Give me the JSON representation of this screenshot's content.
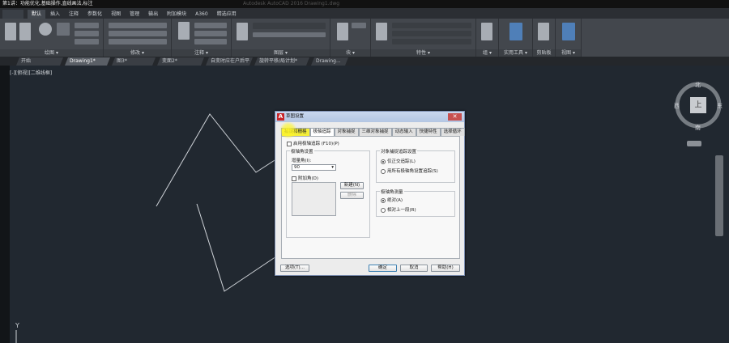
{
  "title_bar": {
    "text": "第1讲：功能优化,基础操作,直线画法,标注",
    "ghost": "Autodesk AutoCAD 2016   Drawing1.dwg"
  },
  "ribbon_tabs": [
    "默认",
    "插入",
    "注释",
    "参数化",
    "视图",
    "管理",
    "输出",
    "附加模块",
    "A360",
    "精选应用"
  ],
  "ribbon_panels": [
    "绘图 ▾",
    "修改 ▾",
    "注释 ▾",
    "图层 ▾",
    "块 ▾",
    "特性 ▾",
    "组 ▾",
    "实用工具 ▾",
    "剪贴板",
    "视图 ▾"
  ],
  "doc_tabs": [
    "开始",
    "Drawing1*",
    "图3*",
    "变面2*",
    "自变时应在户后平面*",
    "旋转平移/局计划*",
    "Drawing..."
  ],
  "view_label": "[-][俯视][二维线框]",
  "viewcube": {
    "north": "北",
    "south": "南",
    "west": "西",
    "east": "东",
    "top": "上"
  },
  "ucs_y": "Y",
  "dialog": {
    "title": "草图设置",
    "close": "✕",
    "tabs": [
      "捕捉和栅格",
      "极轴追踪",
      "对象捕捉",
      "三维对象捕捉",
      "动态输入",
      "快捷特性",
      "选择循环"
    ],
    "enable_polar": "启用极轴追踪 (F10)(P)",
    "polar_group": "极轴角设置",
    "increment_label": "增量角(I):",
    "increment_value": "90",
    "additional_label": "附加角(D)",
    "new_btn": "新建(N)",
    "delete_btn": "删除",
    "osnap_group": "对象捕捉追踪设置",
    "ortho_only": "仅正交追踪(L)",
    "all_polar": "用所有极轴角设置追踪(S)",
    "measure_group": "极轴角测量",
    "absolute": "绝对(A)",
    "relative": "相对上一段(R)",
    "options_btn": "选项(T)...",
    "ok_btn": "确定",
    "cancel_btn": "取消",
    "help_btn": "帮助(H)"
  }
}
